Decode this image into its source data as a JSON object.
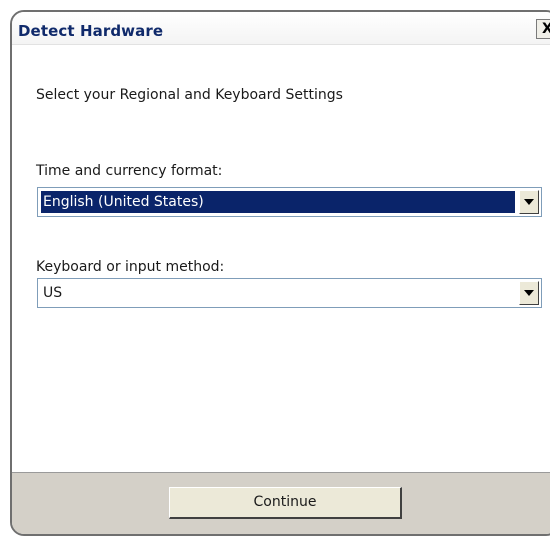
{
  "window": {
    "title": "Detect Hardware",
    "close_label": "X"
  },
  "content": {
    "subtitle": "Select your Regional and Keyboard Settings",
    "time_currency": {
      "label": "Time and currency format:",
      "value": "English (United States)"
    },
    "keyboard": {
      "label": "Keyboard or input method:",
      "value": "US"
    }
  },
  "footer": {
    "continue_label": "Continue"
  },
  "colors": {
    "title_text": "#102a6b",
    "selection_highlight": "#0a246a",
    "footer_background": "#d4d0c8"
  },
  "icons": {
    "close": "close-icon",
    "dropdown": "chevron-down-icon"
  }
}
